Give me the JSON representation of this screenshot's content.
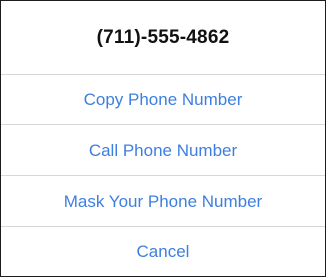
{
  "sheet": {
    "title": "(711)-555-4862",
    "actions": [
      {
        "label": "Copy Phone Number"
      },
      {
        "label": "Call Phone Number"
      },
      {
        "label": "Mask Your Phone Number"
      },
      {
        "label": "Cancel"
      }
    ]
  },
  "colors": {
    "action_text": "#3d7fe0",
    "title_text": "#111111",
    "divider": "#d8d8dc"
  }
}
